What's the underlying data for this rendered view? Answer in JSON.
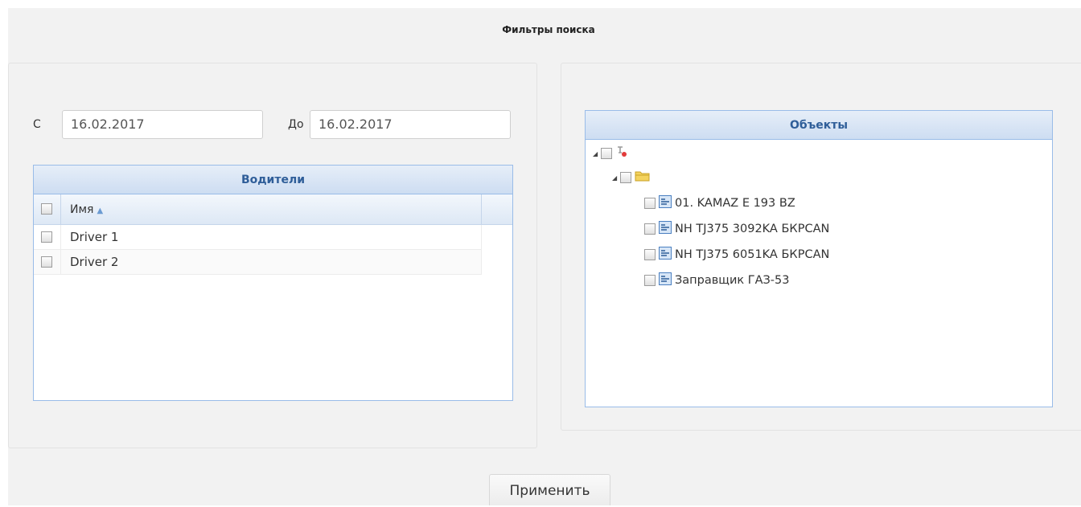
{
  "page": {
    "title": "Фильтры поиска"
  },
  "filters": {
    "from_label": "С",
    "from_value": "16.02.2017",
    "to_label": "До",
    "to_value": "16.02.2017"
  },
  "drivers": {
    "title": "Водители",
    "column_name": "Имя",
    "rows": [
      "Driver 1",
      "Driver 2"
    ]
  },
  "objects": {
    "title": "Объекты",
    "items": [
      "01. KAMAZ E 193 BZ",
      "NH TJ375 3092KA БКРСAN",
      "NH TJ375 6051KA БКРСAN",
      "Заправщик ГАЗ-53"
    ]
  },
  "actions": {
    "apply_label": "Применить"
  },
  "colors": {
    "accent_header": "#2f5e99",
    "grid_border": "#99bce8"
  },
  "icons": {
    "tree_root": "users-group-icon",
    "tree_folder": "folder-icon",
    "tree_object": "vehicle-object-icon"
  }
}
